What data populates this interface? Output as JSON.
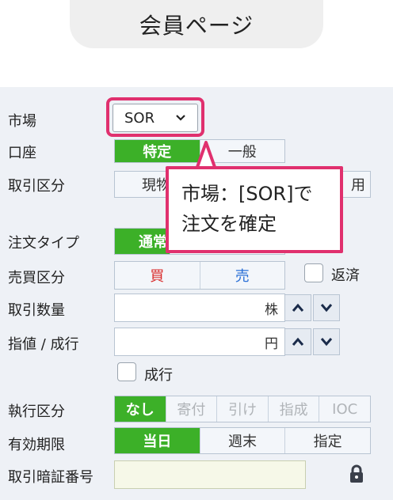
{
  "header": {
    "title": "会員ページ"
  },
  "form": {
    "market": {
      "label": "市場",
      "value": "SOR"
    },
    "account": {
      "label": "口座",
      "options": [
        "特定",
        "一般"
      ]
    },
    "trade_type": {
      "label": "取引区分",
      "options_visible": [
        "現物",
        "用"
      ]
    },
    "order_type": {
      "label": "注文タイプ",
      "selected": "通常"
    },
    "side": {
      "label": "売買区分",
      "buy": "買",
      "sell": "売",
      "repay_label": "返済"
    },
    "quantity": {
      "label": "取引数量",
      "unit": "株"
    },
    "price": {
      "label": "指値 / 成行",
      "unit": "円",
      "market_order_label": "成行"
    },
    "execution": {
      "label": "執行区分",
      "options": [
        "なし",
        "寄付",
        "引け",
        "指成",
        "IOC"
      ]
    },
    "validity": {
      "label": "有効期限",
      "options": [
        "当日",
        "週末",
        "指定"
      ]
    },
    "pin": {
      "label": "取引暗証番号",
      "value": ""
    }
  },
  "callout": {
    "line1": "市場：[SOR]で",
    "line2": "注文を確定"
  },
  "colors": {
    "accent_green": "#3cb028",
    "highlight_pink": "#e0306e",
    "buy_red": "#d92a2a",
    "sell_blue": "#2a6fd6"
  }
}
